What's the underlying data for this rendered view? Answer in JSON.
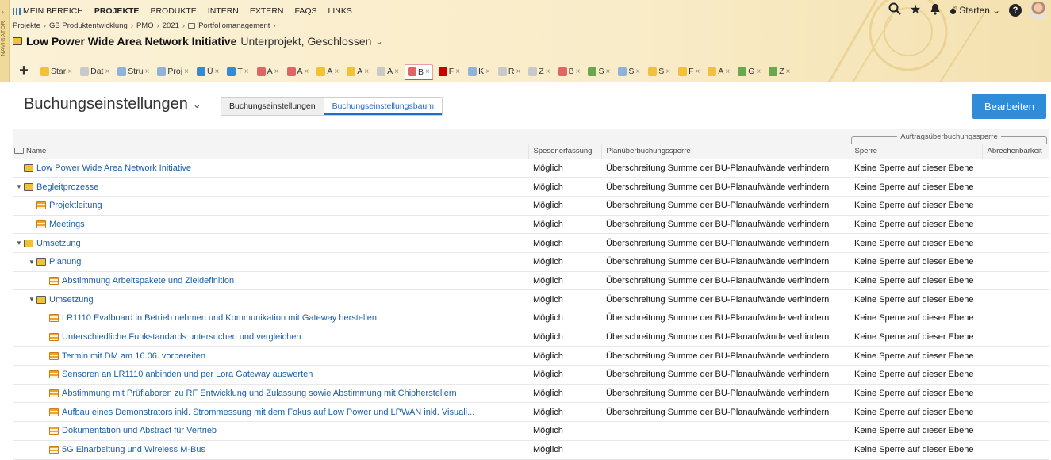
{
  "navigator": {
    "label": "NAVIGATOR"
  },
  "topnav": [
    {
      "label": "MEIN BEREICH",
      "active": false
    },
    {
      "label": "PROJEKTE",
      "active": true
    },
    {
      "label": "PRODUKTE",
      "active": false
    },
    {
      "label": "INTERN",
      "active": false
    },
    {
      "label": "EXTERN",
      "active": false
    },
    {
      "label": "FAQS",
      "active": false
    },
    {
      "label": "LINKS",
      "active": false
    }
  ],
  "top_right": {
    "starten_label": "Starten"
  },
  "breadcrumb": [
    "Projekte",
    "GB Produktentwicklung",
    "PMO",
    "2021",
    "Portfoliomanagement"
  ],
  "project": {
    "title": "Low Power Wide Area Network Initiative",
    "subtitle": "Unterprojekt, Geschlossen"
  },
  "tabs": [
    {
      "label": "Star",
      "color": "#f1c232",
      "active": false
    },
    {
      "label": "Dat",
      "color": "#c9c9c9",
      "active": false
    },
    {
      "label": "Stru",
      "color": "#8fb3d9",
      "active": false
    },
    {
      "label": "Proj",
      "color": "#8fb3d9",
      "active": false
    },
    {
      "label": "Ü",
      "color": "#2f8cd8",
      "active": false
    },
    {
      "label": "T",
      "color": "#2f8cd8",
      "active": false
    },
    {
      "label": "A",
      "color": "#e06666",
      "active": false
    },
    {
      "label": "A",
      "color": "#e06666",
      "active": false
    },
    {
      "label": "A",
      "color": "#f1c232",
      "active": false
    },
    {
      "label": "A",
      "color": "#f1c232",
      "active": false
    },
    {
      "label": "A",
      "color": "#c9c9c9",
      "active": false
    },
    {
      "label": "B",
      "color": "#e06666",
      "active": true
    },
    {
      "label": "F",
      "color": "#cc0000",
      "active": false
    },
    {
      "label": "K",
      "color": "#8fb3d9",
      "active": false
    },
    {
      "label": "R",
      "color": "#c9c9c9",
      "active": false
    },
    {
      "label": "Z",
      "color": "#c9c9c9",
      "active": false
    },
    {
      "label": "B",
      "color": "#e06666",
      "active": false
    },
    {
      "label": "S",
      "color": "#6aa84f",
      "active": false
    },
    {
      "label": "S",
      "color": "#8fb3d9",
      "active": false
    },
    {
      "label": "S",
      "color": "#f1c232",
      "active": false
    },
    {
      "label": "F",
      "color": "#f1c232",
      "active": false
    },
    {
      "label": "A",
      "color": "#f1c232",
      "active": false
    },
    {
      "label": "G",
      "color": "#6aa84f",
      "active": false
    },
    {
      "label": "Z",
      "color": "#6aa84f",
      "active": false
    }
  ],
  "page": {
    "title": "Buchungseinstellungen",
    "toggle": [
      "Buchungseinstellungen",
      "Buchungseinstellungsbaum"
    ],
    "edit_label": "Bearbeiten"
  },
  "table": {
    "group_label": "Auftragsüberbuchungssperre",
    "columns": [
      "Name",
      "Spesenerfassung",
      "Planüberbuchungssperre",
      "Sperre",
      "Abrechenbarkeit"
    ],
    "rows": [
      {
        "level": 0,
        "toggle": "",
        "icon": "folder",
        "name": "Low Power Wide Area Network Initiative",
        "spes": "Möglich",
        "plan": "Überschreitung Summe der BU-Planaufwände verhindern",
        "sperre": "Keine Sperre auf dieser Ebene",
        "abr": ""
      },
      {
        "level": 0,
        "toggle": "▼",
        "icon": "folder",
        "name": "Begleitprozesse",
        "spes": "Möglich",
        "plan": "Überschreitung Summe der BU-Planaufwände verhindern",
        "sperre": "Keine Sperre auf dieser Ebene",
        "abr": ""
      },
      {
        "level": 1,
        "toggle": "",
        "icon": "task",
        "name": "Projektleitung",
        "spes": "Möglich",
        "plan": "Überschreitung Summe der BU-Planaufwände verhindern",
        "sperre": "Keine Sperre auf dieser Ebene",
        "abr": ""
      },
      {
        "level": 1,
        "toggle": "",
        "icon": "task",
        "name": "Meetings",
        "spes": "Möglich",
        "plan": "Überschreitung Summe der BU-Planaufwände verhindern",
        "sperre": "Keine Sperre auf dieser Ebene",
        "abr": ""
      },
      {
        "level": 0,
        "toggle": "▼",
        "icon": "folder",
        "name": "Umsetzung",
        "spes": "Möglich",
        "plan": "Überschreitung Summe der BU-Planaufwände verhindern",
        "sperre": "Keine Sperre auf dieser Ebene",
        "abr": ""
      },
      {
        "level": 1,
        "toggle": "▼",
        "icon": "folder",
        "name": "Planung",
        "spes": "Möglich",
        "plan": "Überschreitung Summe der BU-Planaufwände verhindern",
        "sperre": "Keine Sperre auf dieser Ebene",
        "abr": ""
      },
      {
        "level": 2,
        "toggle": "",
        "icon": "task",
        "name": "Abstimmung Arbeitspakete und Zieldefinition",
        "spes": "Möglich",
        "plan": "Überschreitung Summe der BU-Planaufwände verhindern",
        "sperre": "Keine Sperre auf dieser Ebene",
        "abr": ""
      },
      {
        "level": 1,
        "toggle": "▼",
        "icon": "folder",
        "name": "Umsetzung",
        "spes": "Möglich",
        "plan": "Überschreitung Summe der BU-Planaufwände verhindern",
        "sperre": "Keine Sperre auf dieser Ebene",
        "abr": ""
      },
      {
        "level": 2,
        "toggle": "",
        "icon": "task",
        "name": "LR1110 Evalboard in Betrieb nehmen und Kommunikation mit Gateway herstellen",
        "spes": "Möglich",
        "plan": "Überschreitung Summe der BU-Planaufwände verhindern",
        "sperre": "Keine Sperre auf dieser Ebene",
        "abr": ""
      },
      {
        "level": 2,
        "toggle": "",
        "icon": "task",
        "name": "Unterschiedliche Funkstandards untersuchen und vergleichen",
        "spes": "Möglich",
        "plan": "Überschreitung Summe der BU-Planaufwände verhindern",
        "sperre": "Keine Sperre auf dieser Ebene",
        "abr": ""
      },
      {
        "level": 2,
        "toggle": "",
        "icon": "task",
        "name": "Termin mit DM am 16.06. vorbereiten",
        "spes": "Möglich",
        "plan": "Überschreitung Summe der BU-Planaufwände verhindern",
        "sperre": "Keine Sperre auf dieser Ebene",
        "abr": ""
      },
      {
        "level": 2,
        "toggle": "",
        "icon": "task",
        "name": "Sensoren an LR1110 anbinden und per Lora Gateway auswerten",
        "spes": "Möglich",
        "plan": "Überschreitung Summe der BU-Planaufwände verhindern",
        "sperre": "Keine Sperre auf dieser Ebene",
        "abr": ""
      },
      {
        "level": 2,
        "toggle": "",
        "icon": "task",
        "name": "Abstimmung mit Prüflaboren zu RF Entwicklung und Zulassung sowie Abstimmung mit Chipherstellern",
        "spes": "Möglich",
        "plan": "Überschreitung Summe der BU-Planaufwände verhindern",
        "sperre": "Keine Sperre auf dieser Ebene",
        "abr": ""
      },
      {
        "level": 2,
        "toggle": "",
        "icon": "task",
        "name": "Aufbau eines Demonstrators inkl. Strommessung mit dem Fokus auf Low Power und LPWAN inkl. Visuali...",
        "spes": "Möglich",
        "plan": "Überschreitung Summe der BU-Planaufwände verhindern",
        "sperre": "Keine Sperre auf dieser Ebene",
        "abr": ""
      },
      {
        "level": 2,
        "toggle": "",
        "icon": "task",
        "name": "Dokumentation und Abstract für Vertrieb",
        "spes": "Möglich",
        "plan": "",
        "sperre": "Keine Sperre auf dieser Ebene",
        "abr": ""
      },
      {
        "level": 2,
        "toggle": "",
        "icon": "task",
        "name": "5G Einarbeitung und Wireless M-Bus",
        "spes": "Möglich",
        "plan": "",
        "sperre": "Keine Sperre auf dieser Ebene",
        "abr": ""
      }
    ]
  }
}
